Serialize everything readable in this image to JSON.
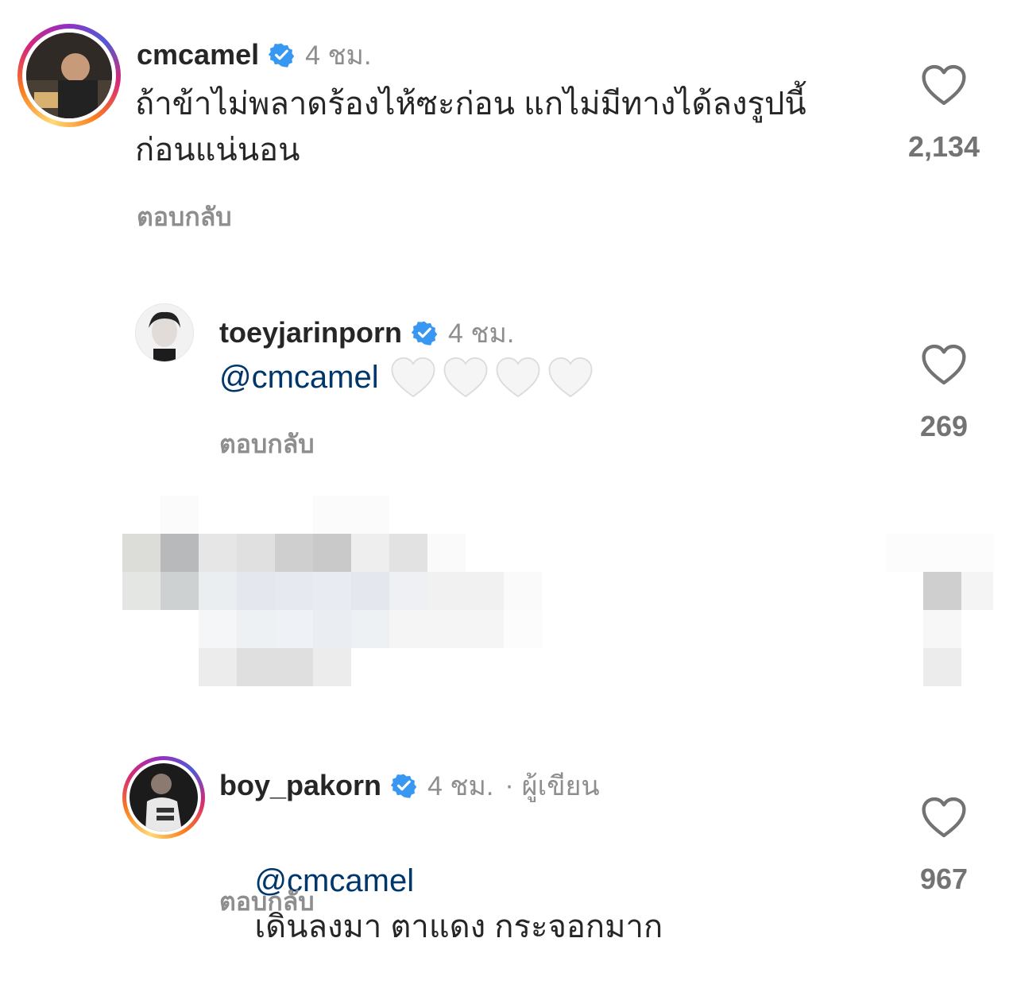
{
  "comments": [
    {
      "username": "cmcamel",
      "time": "4 ชม.",
      "text": "ถ้าข้าไม่พลาดร้องไห้ซะก่อน แกไม่มีทางได้ลงรูปนี้\nก่อนแน่นอน",
      "reply_label": "ตอบกลับ",
      "likes": "2,134",
      "avatar_ring": true
    },
    {
      "username": "toeyjarinporn",
      "time": "4 ชม.",
      "mention": "@cmcamel",
      "emoji": [
        "🤍",
        "🤍",
        "🤍",
        "🤍"
      ],
      "reply_label": "ตอบกลับ",
      "likes": "269",
      "avatar_ring": false
    },
    {
      "username": "boy_pakorn",
      "time": "4 ชม.",
      "author_label": "ผู้เขียน",
      "mention": "@cmcamel",
      "text": "เดินลงมา ตาแดง กระจอกมาก",
      "reply_label": "ตอบกลับ",
      "likes": "967",
      "avatar_ring": true
    }
  ],
  "colors": {
    "verified": "#3897f0",
    "mention": "#00376b",
    "secondary_text": "#8e8e8e"
  },
  "icons": {
    "like": "heart-outline-icon",
    "verified": "verified-badge-icon"
  },
  "redacted_comment": "pixelated-comment"
}
